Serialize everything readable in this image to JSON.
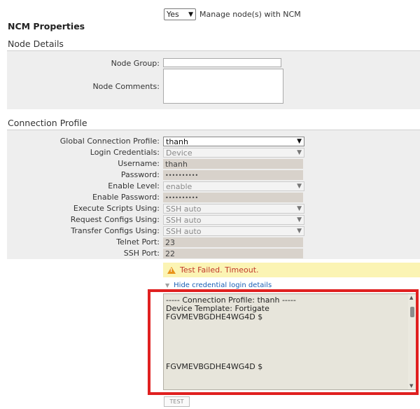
{
  "manage": {
    "selected": "Yes",
    "label": "Manage node(s) with NCM"
  },
  "ncm_title": "NCM Properties",
  "node_details": {
    "title": "Node Details",
    "group_label": "Node Group:",
    "group_value": "",
    "comments_label": "Node Comments:",
    "comments_value": ""
  },
  "connection_profile": {
    "title": "Connection Profile",
    "global_label": "Global Connection Profile:",
    "global_value": "thanh",
    "login_label": "Login Credentials:",
    "login_value": "Device",
    "username_label": "Username:",
    "username_value": "thanh",
    "password_label": "Password:",
    "password_value": "••••••••••",
    "enable_level_label": "Enable Level:",
    "enable_level_value": "enable",
    "enable_password_label": "Enable Password:",
    "enable_password_value": "••••••••••",
    "execute_label": "Execute Scripts Using:",
    "execute_value": "SSH auto",
    "request_label": "Request Configs Using:",
    "request_value": "SSH auto",
    "transfer_label": "Transfer Configs Using:",
    "transfer_value": "SSH auto",
    "telnet_label": "Telnet Port:",
    "telnet_value": "23",
    "ssh_label": "SSH Port:",
    "ssh_value": "22"
  },
  "test": {
    "warning": "Test Failed. Timeout.",
    "hide_link": "Hide credential login details",
    "console_lines": [
      "----- Connection Profile: thanh -----",
      "Device Template: Fortigate",
      "FGVMEVBGDHE4WG4D $",
      "FGVMEVBGDHE4WG4D $"
    ],
    "button": "TEST"
  },
  "icons": {
    "warning": "warning-icon",
    "dropdown": "chevron-down-icon",
    "expand": "triangle-down-icon"
  },
  "colors": {
    "warning_bg": "#fbf4b4",
    "warning_text": "#c0392b",
    "highlight": "#e02020",
    "link": "#1a5fb4"
  }
}
